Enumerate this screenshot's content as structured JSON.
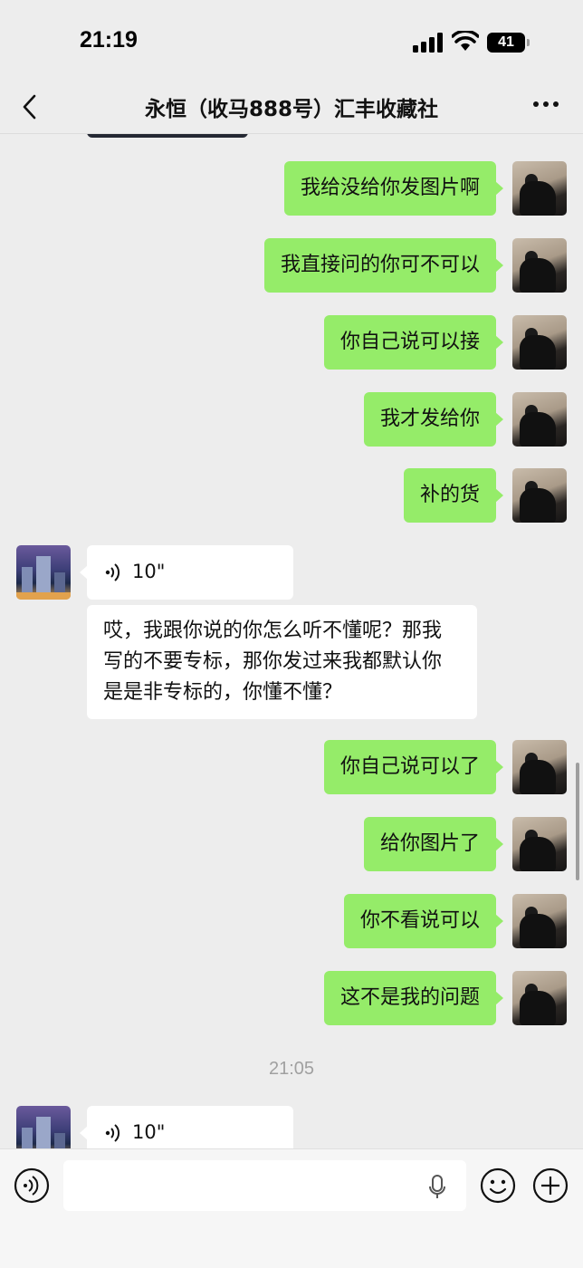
{
  "status_bar": {
    "time": "21:19",
    "battery": "41"
  },
  "nav": {
    "title": "永恒（收马888号）汇丰收藏社"
  },
  "messages_block_1": [
    {
      "text": "我给没给你发图片啊"
    },
    {
      "text": "我直接问的你可不可以"
    },
    {
      "text": "你自己说可以接"
    },
    {
      "text": "我才发给你"
    },
    {
      "text": "补的货"
    }
  ],
  "incoming_1": {
    "voice_duration": "10\"",
    "text": "哎，我跟你说的你怎么听不懂呢？那我写的不要专标，那你发过来我都默认你是是非专标的，你懂不懂？"
  },
  "messages_block_2": [
    {
      "text": "你自己说可以了"
    },
    {
      "text": "给你图片了"
    },
    {
      "text": "你不看说可以"
    },
    {
      "text": "这不是我的问题"
    }
  ],
  "timestamp": "21:05",
  "incoming_2": {
    "voice_duration": "10\""
  },
  "input_bar": {
    "placeholder": ""
  },
  "colors": {
    "outgoing_bubble": "#95ec69",
    "incoming_bubble": "#ffffff",
    "background": "#ededed"
  }
}
